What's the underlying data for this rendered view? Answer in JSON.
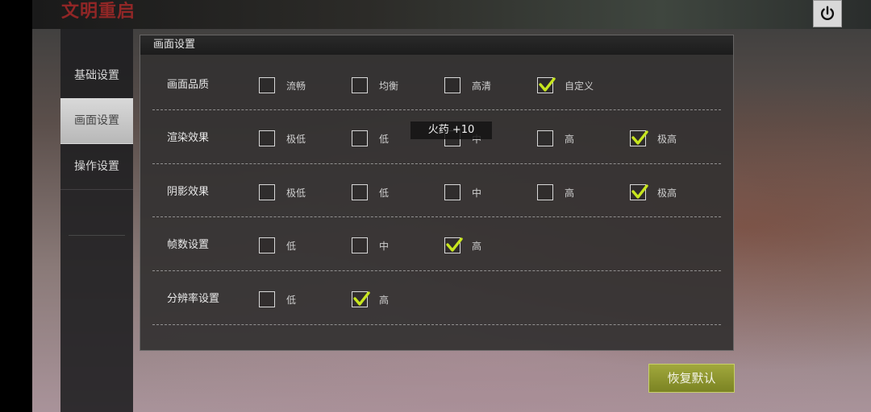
{
  "logo_text": "文明重启",
  "sidebar": {
    "items": [
      {
        "label": "基础设置",
        "active": false
      },
      {
        "label": "画面设置",
        "active": true
      },
      {
        "label": "操作设置",
        "active": false
      }
    ]
  },
  "panel": {
    "title": "画面设置",
    "rows": [
      {
        "label": "画面品质",
        "options": [
          {
            "label": "流畅",
            "checked": false
          },
          {
            "label": "均衡",
            "checked": false
          },
          {
            "label": "高清",
            "checked": false
          },
          {
            "label": "自定义",
            "checked": true
          }
        ]
      },
      {
        "label": "渲染效果",
        "options": [
          {
            "label": "极低",
            "checked": false
          },
          {
            "label": "低",
            "checked": false
          },
          {
            "label": "中",
            "checked": false
          },
          {
            "label": "高",
            "checked": false
          },
          {
            "label": "极高",
            "checked": true
          }
        ]
      },
      {
        "label": "阴影效果",
        "options": [
          {
            "label": "极低",
            "checked": false
          },
          {
            "label": "低",
            "checked": false
          },
          {
            "label": "中",
            "checked": false
          },
          {
            "label": "高",
            "checked": false
          },
          {
            "label": "极高",
            "checked": true
          }
        ]
      },
      {
        "label": "帧数设置",
        "options": [
          {
            "label": "低",
            "checked": false
          },
          {
            "label": "中",
            "checked": false
          },
          {
            "label": "高",
            "checked": true
          }
        ]
      },
      {
        "label": "分辨率设置",
        "options": [
          {
            "label": "低",
            "checked": false
          },
          {
            "label": "高",
            "checked": true
          }
        ]
      }
    ]
  },
  "toast": "火药 +10",
  "reset_button": "恢复默认",
  "colors": {
    "check": "#c8e61e",
    "reset_button": "#8f9730"
  },
  "icons": {
    "power": "power-icon",
    "check": "check-icon"
  }
}
